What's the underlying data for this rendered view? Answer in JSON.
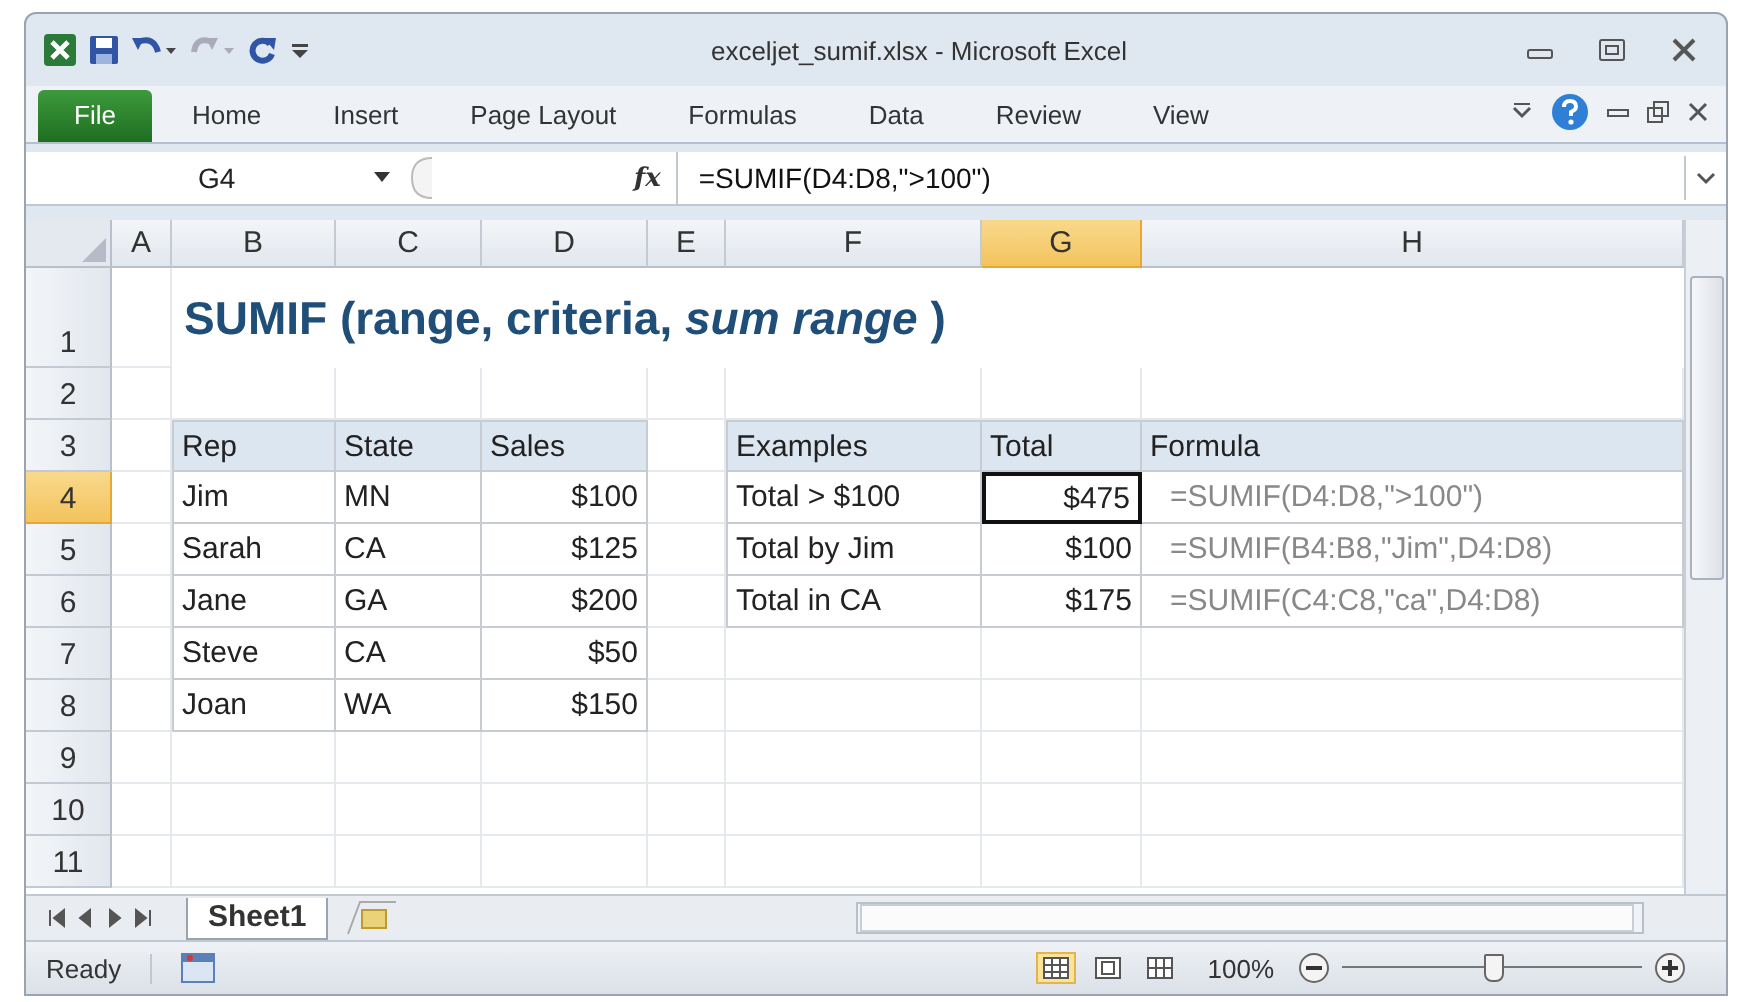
{
  "window": {
    "title": "exceljet_sumif.xlsx - Microsoft Excel"
  },
  "ribbon_tabs": [
    {
      "label": "File",
      "kind": "file"
    },
    {
      "label": "Home",
      "kind": "tab"
    },
    {
      "label": "Insert",
      "kind": "tab"
    },
    {
      "label": "Page Layout",
      "kind": "tab"
    },
    {
      "label": "Formulas",
      "kind": "tab"
    },
    {
      "label": "Data",
      "kind": "tab"
    },
    {
      "label": "Review",
      "kind": "tab"
    },
    {
      "label": "View",
      "kind": "tab"
    }
  ],
  "formula_bar": {
    "name_box": "G4",
    "fx": "fx",
    "formula": "=SUMIF(D4:D8,\">100\")"
  },
  "column_headers": [
    {
      "label": "A",
      "selected": false
    },
    {
      "label": "B",
      "selected": false
    },
    {
      "label": "C",
      "selected": false
    },
    {
      "label": "D",
      "selected": false
    },
    {
      "label": "E",
      "selected": false
    },
    {
      "label": "F",
      "selected": false
    },
    {
      "label": "G",
      "selected": true
    },
    {
      "label": "H",
      "selected": false
    }
  ],
  "row_headers": [
    {
      "label": "1",
      "selected": false
    },
    {
      "label": "2",
      "selected": false
    },
    {
      "label": "3",
      "selected": false
    },
    {
      "label": "4",
      "selected": true
    },
    {
      "label": "5",
      "selected": false
    },
    {
      "label": "6",
      "selected": false
    },
    {
      "label": "7",
      "selected": false
    },
    {
      "label": "8",
      "selected": false
    },
    {
      "label": "9",
      "selected": false
    },
    {
      "label": "10",
      "selected": false
    },
    {
      "label": "11",
      "selected": false
    }
  ],
  "sheet_title": "SUMIF (range, criteria, *sum range* )",
  "data_table": {
    "columns": [
      "Rep",
      "State",
      "Sales"
    ],
    "rows": [
      [
        "Jim",
        "MN",
        "$100"
      ],
      [
        "Sarah",
        "CA",
        "$125"
      ],
      [
        "Jane",
        "GA",
        "$200"
      ],
      [
        "Steve",
        "CA",
        "$50"
      ],
      [
        "Joan",
        "WA",
        "$150"
      ]
    ]
  },
  "examples_table": {
    "columns": [
      "Examples",
      "Total",
      "Formula"
    ],
    "rows": [
      {
        "example": "Total > $100",
        "total": "$475",
        "formula": "=SUMIF(D4:D8,\">100\")",
        "selected": true
      },
      {
        "example": "Total by Jim",
        "total": "$100",
        "formula": "=SUMIF(B4:B8,\"Jim\",D4:D8)",
        "selected": false
      },
      {
        "example": "Total in CA",
        "total": "$175",
        "formula": "=SUMIF(C4:C8,\"ca\",D4:D8)",
        "selected": false
      }
    ]
  },
  "sheet_tabs": [
    {
      "label": "Sheet1",
      "selected": true
    }
  ],
  "status_bar": {
    "status": "Ready",
    "views": [
      {
        "kind": "normal",
        "selected": true
      },
      {
        "kind": "page-layout",
        "selected": false
      },
      {
        "kind": "page-break",
        "selected": false
      }
    ],
    "zoom": "100%",
    "zoom_slider": {
      "level": 0.5
    }
  }
}
